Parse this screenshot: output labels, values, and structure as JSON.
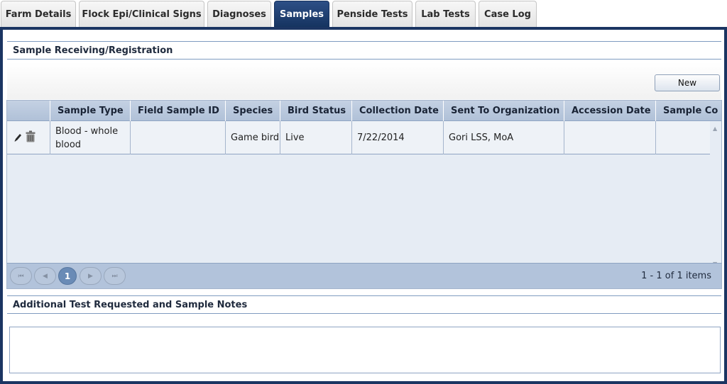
{
  "tabs": [
    {
      "label": "Farm Details",
      "active": false
    },
    {
      "label": "Flock Epi/Clinical Signs",
      "active": false
    },
    {
      "label": "Diagnoses",
      "active": false
    },
    {
      "label": "Samples",
      "active": true
    },
    {
      "label": "Penside Tests",
      "active": false
    },
    {
      "label": "Lab Tests",
      "active": false
    },
    {
      "label": "Case Log",
      "active": false
    }
  ],
  "samples_section": {
    "title": "Sample Receiving/Registration",
    "new_button_label": "New"
  },
  "grid": {
    "columns": [
      "Sample Type",
      "Field Sample ID",
      "Species",
      "Bird Status",
      "Collection Date",
      "Sent To Organization",
      "Accession Date",
      "Sample Co"
    ],
    "rows": [
      {
        "sample_type": "Blood - whole blood",
        "field_sample_id": "",
        "species": "Game bird",
        "bird_status": "Live",
        "collection_date": "7/22/2014",
        "sent_to_organization": "Gori LSS, MoA",
        "accession_date": "",
        "sample_condition": ""
      }
    ],
    "row_icons": [
      "pencil-icon",
      "trash-icon"
    ]
  },
  "pager": {
    "current_page": "1",
    "info": "1 - 1 of 1 items",
    "first_glyph": "⏮",
    "prev_glyph": "◀",
    "next_glyph": "▶",
    "last_glyph": "⏭"
  },
  "notes_section": {
    "title": "Additional Test Requested and Sample Notes",
    "value": ""
  },
  "colors": {
    "active_tab": "#1b3562",
    "grid_header": "#b8c7dc",
    "pager_bg": "#b2c3db"
  }
}
